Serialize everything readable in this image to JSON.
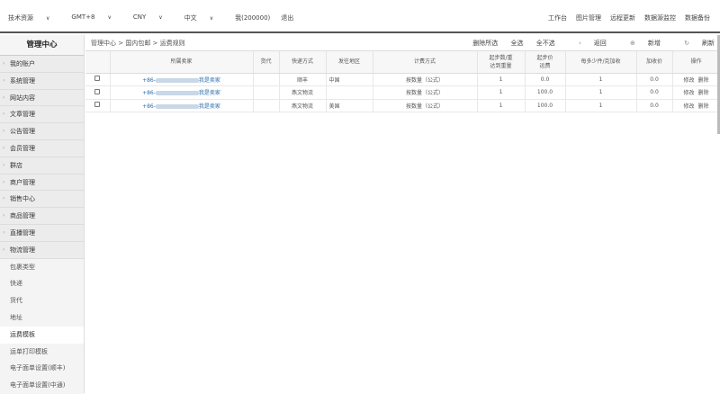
{
  "topbar": {
    "left": [
      {
        "label": "技术资源",
        "caret": true
      },
      {
        "label": "GMT+8",
        "caret": true
      },
      {
        "label": "CNY",
        "caret": true
      },
      {
        "label": "中文",
        "caret": true
      },
      {
        "label": "我(200000)",
        "caret": false
      },
      {
        "label": "退出",
        "caret": false
      }
    ],
    "right": [
      "工作台",
      "图片管理",
      "远程更新",
      "数据源监控",
      "数据备份"
    ]
  },
  "sidebar": {
    "title": "管理中心",
    "items": [
      "我的账户",
      "系统管理",
      "网站内容",
      "文章管理",
      "公告管理",
      "会员管理",
      "群店",
      "商户管理",
      "销售中心",
      "商品管理",
      "直播管理",
      "物流管理"
    ],
    "subitems": [
      "包裹类型",
      "快递",
      "货代",
      "地址",
      "运费模板",
      "运单打印模板",
      "电子面单设置(顺丰)",
      "电子面单设置(中通)"
    ],
    "active_sub": "运费模板"
  },
  "breadcrumb": "管理中心 > 国内包邮 > 运费规则",
  "actions": {
    "delete_selected": "删除所选",
    "select_all": "全选",
    "deselect_all": "全不选",
    "back": "返回",
    "add": "新增",
    "refresh": "刷新"
  },
  "table": {
    "headers": [
      "",
      "所属卖家",
      "货代",
      "快递方式",
      "发往地区",
      "计费方式",
      "起步数/重\n达到重量",
      "起步价\n运费",
      "每多少件/克加收",
      "加收价",
      "操作"
    ],
    "rows": [
      {
        "seller_prefix": "+86-",
        "seller_suffix": "我是卖家",
        "agent": "",
        "express": "顺丰",
        "region": "中国",
        "billing": "按数量（公式）",
        "start_qty": "1",
        "start_price": "0.0",
        "per": "1",
        "extra": "0.0",
        "edit": "修改",
        "delete": "删除"
      },
      {
        "seller_prefix": "+86-",
        "seller_suffix": "我是卖家",
        "agent": "",
        "express": "燕文物流",
        "region": "",
        "billing": "按数量（公式）",
        "start_qty": "1",
        "start_price": "100.0",
        "per": "1",
        "extra": "0.0",
        "edit": "修改",
        "delete": "删除"
      },
      {
        "seller_prefix": "+86-",
        "seller_suffix": "我是卖家",
        "agent": "",
        "express": "燕文物流",
        "region": "美国",
        "billing": "按数量（公式）",
        "start_qty": "1",
        "start_price": "100.0",
        "per": "1",
        "extra": "0.0",
        "edit": "修改",
        "delete": "删除"
      }
    ]
  }
}
